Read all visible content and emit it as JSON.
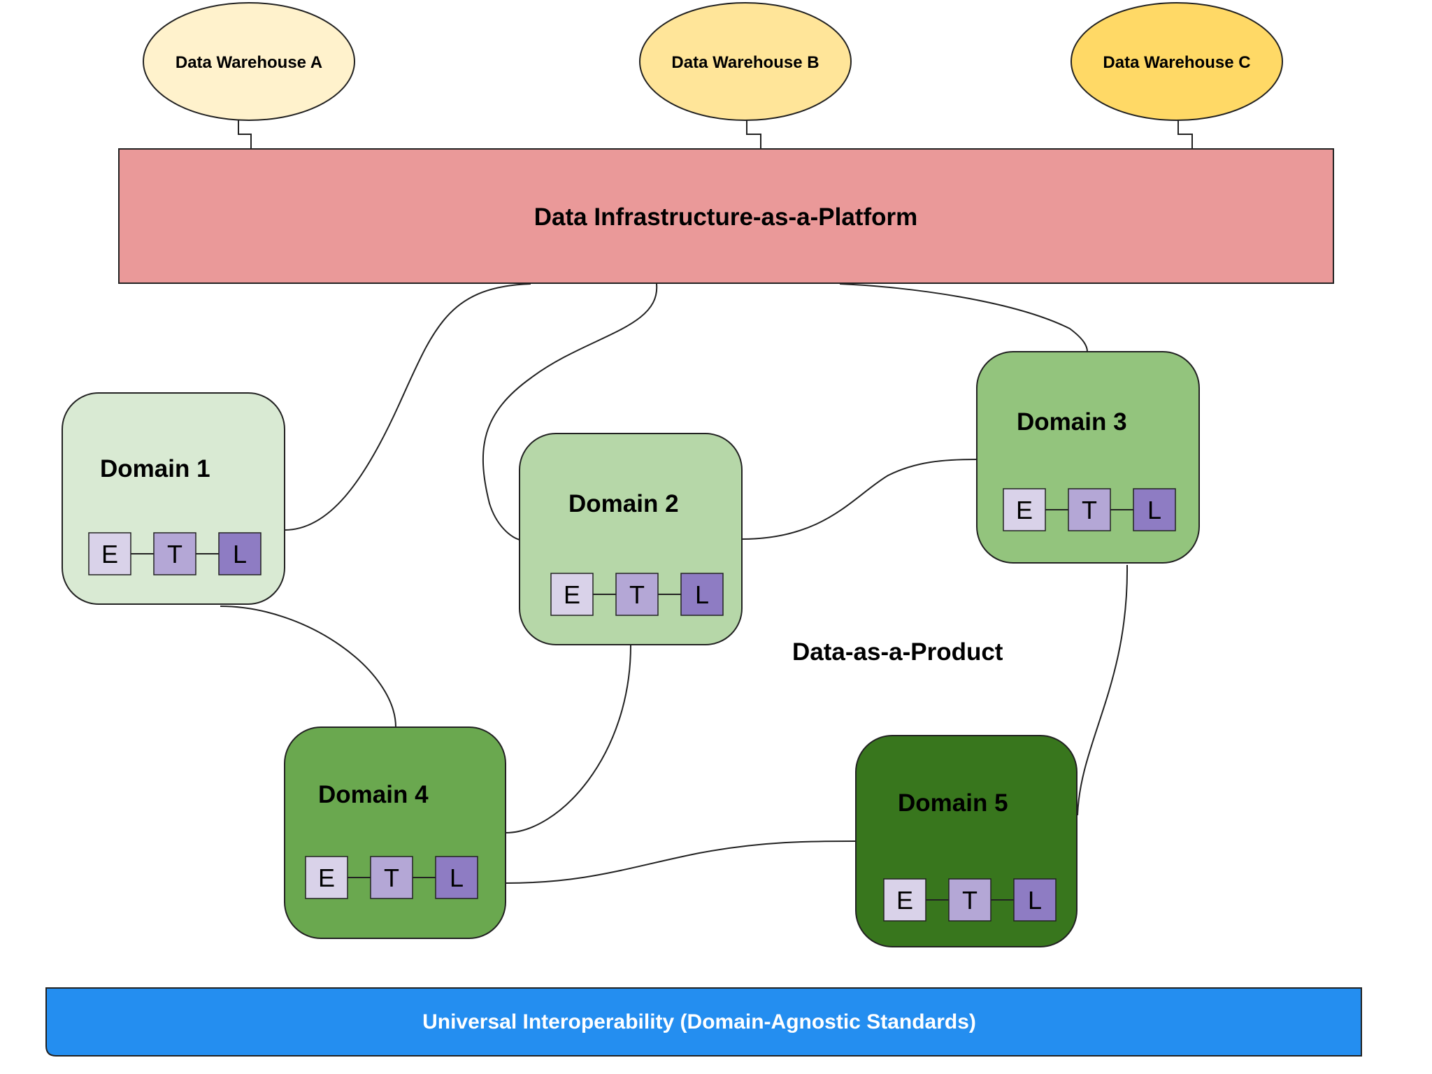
{
  "warehouses": [
    {
      "id": "A",
      "label": "Data Warehouse A",
      "color": "#fff2cc"
    },
    {
      "id": "B",
      "label": "Data Warehouse B",
      "color": "#ffe599"
    },
    {
      "id": "C",
      "label": "Data Warehouse C",
      "color": "#ffd966"
    }
  ],
  "platform": {
    "label": "Data Infrastructure-as-a-Platform",
    "color": "#ea9999"
  },
  "domains": [
    {
      "label": "Domain 1",
      "color": "#d9ead3"
    },
    {
      "label": "Domain 2",
      "color": "#b6d7a8"
    },
    {
      "label": "Domain 3",
      "color": "#93c47d"
    },
    {
      "label": "Domain 4",
      "color": "#6aa84f"
    },
    {
      "label": "Domain 5",
      "color": "#38761d"
    }
  ],
  "etl": [
    {
      "label": "E",
      "color": "#d9d2e9"
    },
    {
      "label": "T",
      "color": "#b4a7d6"
    },
    {
      "label": "L",
      "color": "#8e7cc3"
    }
  ],
  "product_label": "Data-as-a-Product",
  "standards": {
    "label": "Universal Interoperability (Domain-Agnostic Standards)",
    "color": "#248ef0"
  },
  "connections": [
    {
      "from": "Data Warehouse A",
      "to": "Data Infrastructure-as-a-Platform"
    },
    {
      "from": "Data Warehouse B",
      "to": "Data Infrastructure-as-a-Platform"
    },
    {
      "from": "Data Warehouse C",
      "to": "Data Infrastructure-as-a-Platform"
    },
    {
      "from": "Data Infrastructure-as-a-Platform",
      "to": "Domain 1"
    },
    {
      "from": "Data Infrastructure-as-a-Platform",
      "to": "Domain 2"
    },
    {
      "from": "Data Infrastructure-as-a-Platform",
      "to": "Domain 3"
    },
    {
      "from": "Domain 2",
      "to": "Domain 3"
    },
    {
      "from": "Domain 1",
      "to": "Domain 4"
    },
    {
      "from": "Domain 2",
      "to": "Domain 4"
    },
    {
      "from": "Domain 4",
      "to": "Domain 5"
    },
    {
      "from": "Domain 3",
      "to": "Domain 5"
    }
  ]
}
